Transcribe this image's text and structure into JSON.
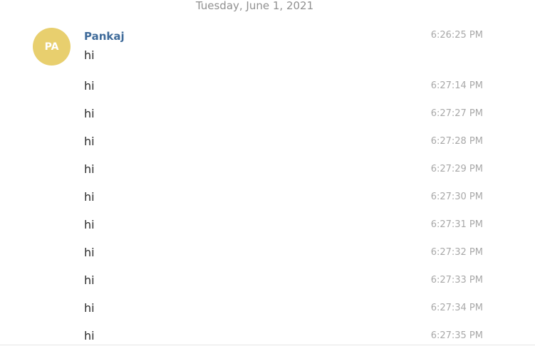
{
  "date_divider": "Tuesday, June 1, 2021",
  "group": {
    "avatar_initials": "PA",
    "avatar_color": "#e8cf6e",
    "sender_name": "Pankaj",
    "sender_color": "#3f6b9a",
    "messages": [
      {
        "text": "hi",
        "time": "6:26:25 PM"
      },
      {
        "text": "hi",
        "time": "6:27:14 PM"
      },
      {
        "text": "hi",
        "time": "6:27:27 PM"
      },
      {
        "text": "hi",
        "time": "6:27:28 PM"
      },
      {
        "text": "hi",
        "time": "6:27:29 PM"
      },
      {
        "text": "hi",
        "time": "6:27:30 PM"
      },
      {
        "text": "hi",
        "time": "6:27:31 PM"
      },
      {
        "text": "hi",
        "time": "6:27:32 PM"
      },
      {
        "text": "hi",
        "time": "6:27:33 PM"
      },
      {
        "text": "hi",
        "time": "6:27:34 PM"
      },
      {
        "text": "hi",
        "time": "6:27:35 PM"
      }
    ]
  }
}
